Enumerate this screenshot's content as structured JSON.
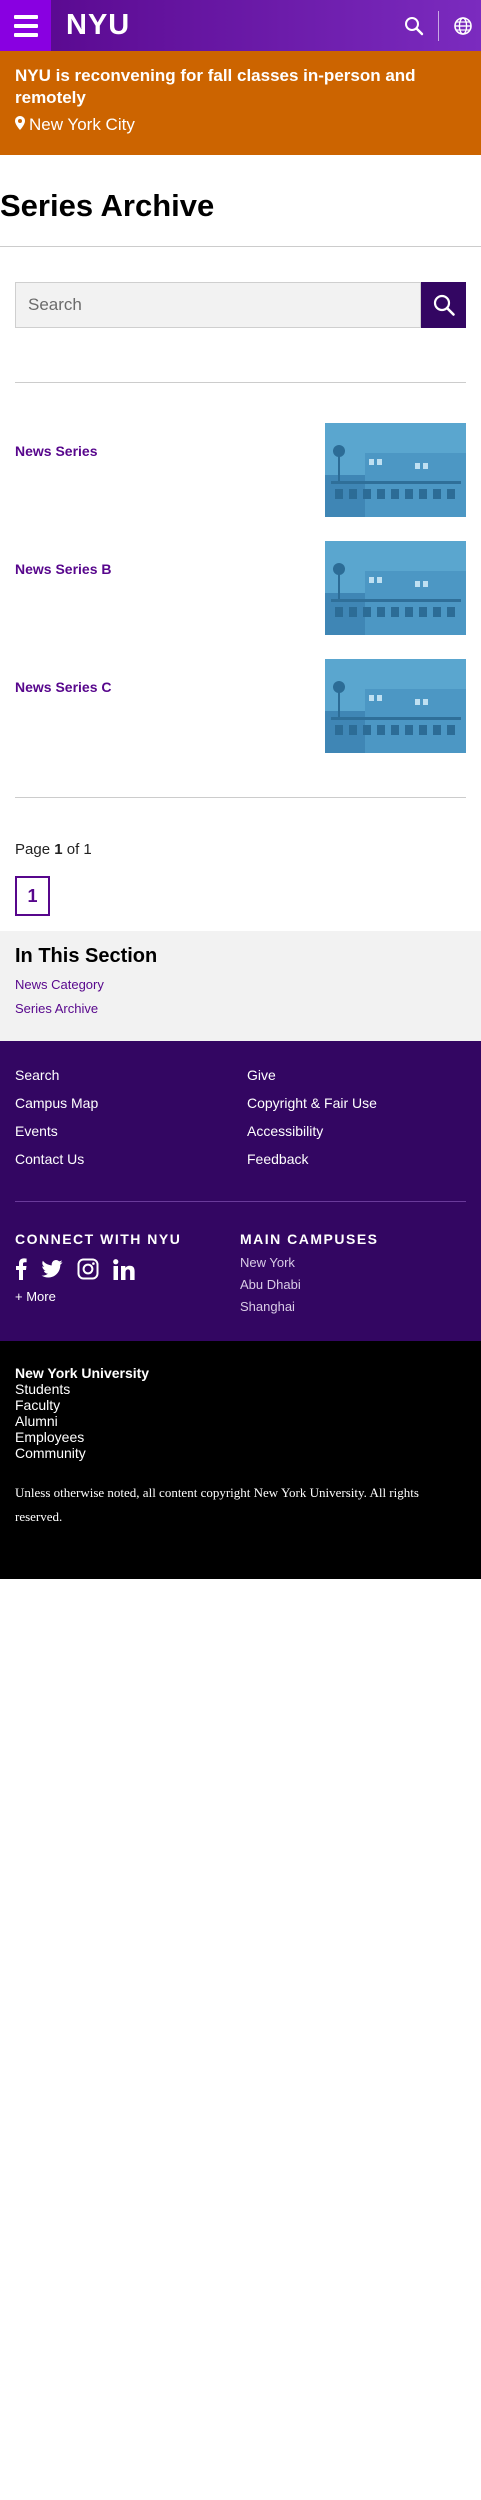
{
  "header": {
    "logo": "NYU",
    "menu_icon": "hamburger-menu-icon",
    "search_icon": "search-icon",
    "globe_icon": "globe-icon",
    "brand_color": "#57068c"
  },
  "alert": {
    "title": "NYU is reconvening for fall classes in-person and remotely",
    "location": "New York City",
    "location_icon": "map-pin-icon",
    "color": "#cc6400"
  },
  "page": {
    "title": "Series Archive"
  },
  "search": {
    "placeholder": "Search"
  },
  "items": [
    {
      "title": "News Series"
    },
    {
      "title": "News Series B"
    },
    {
      "title": "News Series C"
    }
  ],
  "pagination": {
    "prefix": "Page",
    "current": "1",
    "of": "of",
    "total": "1",
    "button": "1"
  },
  "in_this_section": {
    "heading": "In This Section",
    "links": [
      "News Category",
      "Series Archive"
    ]
  },
  "footer": {
    "links_left": [
      "Search",
      "Campus Map",
      "Events",
      "Contact Us"
    ],
    "links_right": [
      "Give",
      "Copyright & Fair Use",
      "Accessibility",
      "Feedback"
    ],
    "connect_heading": "CONNECT WITH NYU",
    "social_icons": [
      "facebook-icon",
      "twitter-icon",
      "instagram-icon",
      "linkedin-icon"
    ],
    "more": "+ More",
    "campuses_heading": "MAIN CAMPUSES",
    "campuses": [
      "New York",
      "Abu Dhabi",
      "Shanghai"
    ],
    "university": "New York University",
    "audience_links": [
      "Students",
      "Faculty",
      "Alumni",
      "Employees",
      "Community"
    ],
    "copyright": "Unless otherwise noted, all content copyright New York University. All rights reserved."
  }
}
